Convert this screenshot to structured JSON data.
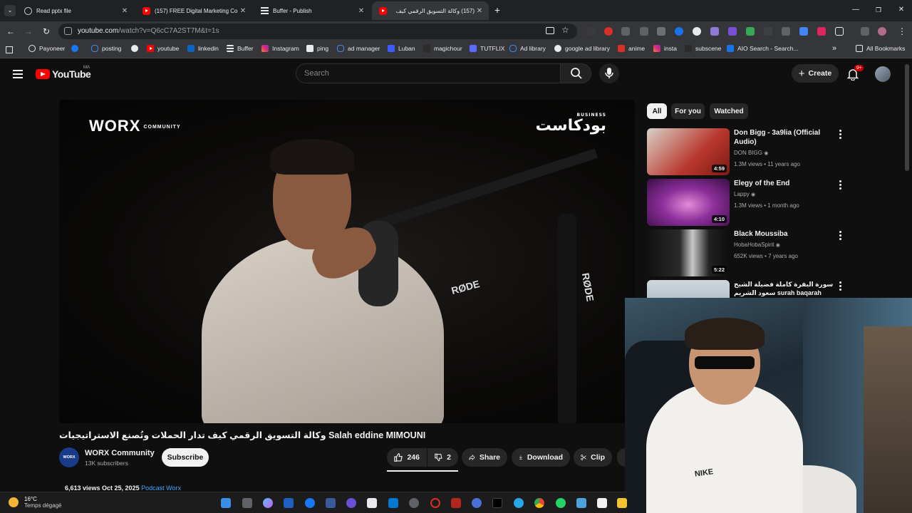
{
  "browser": {
    "tabs": [
      {
        "title": "Read pptx file",
        "active": false
      },
      {
        "title": "(157) FREE Digital Marketing Co",
        "active": false
      },
      {
        "title": "Buffer - Publish",
        "active": false
      },
      {
        "title": "(157) وكالة التسويق الرقمي كيف",
        "active": true
      }
    ],
    "new_tab_label": "+",
    "url_host": "youtube.com",
    "url_path": "/watch?v=Q6cC7A2ST7M&t=1s",
    "bookmarks": [
      "Payoneer",
      "posting",
      "youtube",
      "linkedin",
      "Buffer",
      "Instagram",
      "ping",
      "ad manager",
      "Luban",
      "magichour",
      "TUTFLIX",
      "Ad library",
      "google ad library",
      "anime",
      "insta",
      "subscene",
      "AIO Search - Search..."
    ],
    "all_bookmarks": "All Bookmarks",
    "window_controls": [
      "—",
      "❐",
      "✕"
    ]
  },
  "youtube": {
    "logo_text": "YouTube",
    "country_code": "MA",
    "search_placeholder": "Search",
    "create_label": "Create",
    "notif_badge": "9+"
  },
  "player": {
    "brand_left": "WORX",
    "brand_left_sub": "COMMUNITY",
    "brand_right": "بودكاست",
    "brand_right_sup": "BUSINESS",
    "mic_text_1": "RØDE",
    "mic_text_2": "RØDE"
  },
  "video": {
    "title": "وكالة التسويق الرقمي كيف تدار الحملات وتُصنع الاستراتيجيات Salah eddine MIMOUNI",
    "channel_avatar_text": "WORX",
    "channel_name": "WORX Community",
    "subscribers": "13K subscribers",
    "subscribe_label": "Subscribe",
    "likes": "246",
    "dislikes": "2",
    "share_label": "Share",
    "download_label": "Download",
    "clip_label": "Clip",
    "views_date": "6,613 views  Oct 25, 2025",
    "desc_link": "Podcast Worx"
  },
  "sidebar": {
    "chips": [
      "All",
      "For you",
      "Watched"
    ],
    "recommendations": [
      {
        "title": "Don Bigg - 3a9lia (Official Audio)",
        "channel": "DON BIGG",
        "meta": "1.3M views • 11 years ago",
        "duration": "4:59"
      },
      {
        "title": "Elegy of the End",
        "channel": "Lappy",
        "meta": "1.3M views • 1 month ago",
        "duration": "4:10"
      },
      {
        "title": "Black Moussiba",
        "channel": "HobaHobaSpirit",
        "meta": "652K views • 7 years ago",
        "duration": "5:22"
      },
      {
        "title": "سورة البقرة كاملة فضيلة الشيخ سعود الشريم surah baqarah saud shuraim",
        "channel": "",
        "meta": "",
        "duration": ""
      }
    ]
  },
  "taskbar": {
    "temperature": "16°C",
    "weather": "Temps dégagé"
  },
  "colors": {
    "yt_red": "#ff0000",
    "bg": "#0f0f0f",
    "chrome_dark": "#202124",
    "chrome_mid": "#35363a",
    "link_blue": "#3ea6ff"
  }
}
